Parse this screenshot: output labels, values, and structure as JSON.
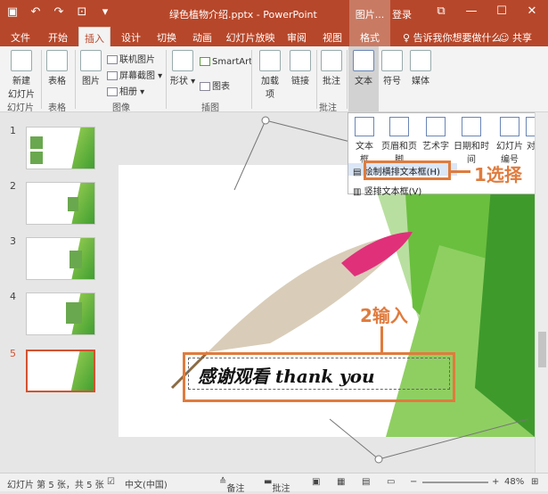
{
  "window": {
    "title": "绿色植物介绍.pptx - PowerPoint",
    "context_tools": "图片...",
    "login": "登录",
    "share": "共享",
    "tell_me": "告诉我你想要做什么"
  },
  "tabs": [
    "文件",
    "开始",
    "插入",
    "设计",
    "切换",
    "动画",
    "幻灯片放映",
    "审阅",
    "视图",
    "格式"
  ],
  "active_tab": "插入",
  "ribbon": {
    "new_slide": "新建\n幻灯片",
    "table": "表格",
    "picture": "图片",
    "online_picture": "联机图片",
    "screenshot": "屏幕截图",
    "album": "相册",
    "shapes": "形状",
    "smartart": "SmartArt",
    "chart": "图表",
    "addins": "加载\n项",
    "link": "链接",
    "comment": "批注",
    "text": "文本",
    "symbol": "符号",
    "media": "媒体",
    "groups": [
      "幻灯片",
      "表格",
      "图像",
      "插图",
      "批注"
    ]
  },
  "text_dropdown": {
    "buttons": [
      "文本框",
      "页眉和页脚",
      "艺术字",
      "日期和时间",
      "幻灯片\n编号",
      "对象"
    ],
    "menu": [
      "绘制横排文本框(H)",
      "竖排文本框(V)"
    ]
  },
  "slides": [
    {
      "num": "1"
    },
    {
      "num": "2"
    },
    {
      "num": "3"
    },
    {
      "num": "4"
    },
    {
      "num": "5"
    }
  ],
  "slide_text": "感谢观看 thank you",
  "callouts": {
    "step1": "1选择",
    "step2": "2输入"
  },
  "status": {
    "slide_info": "幻灯片 第 5 张，共 5 张",
    "language": "中文(中国)",
    "notes": "备注",
    "comments": "批注",
    "zoom": "48%"
  },
  "colors": {
    "accent": "#b7472a",
    "callout": "#e07b3d",
    "green": "#6abf3e"
  }
}
